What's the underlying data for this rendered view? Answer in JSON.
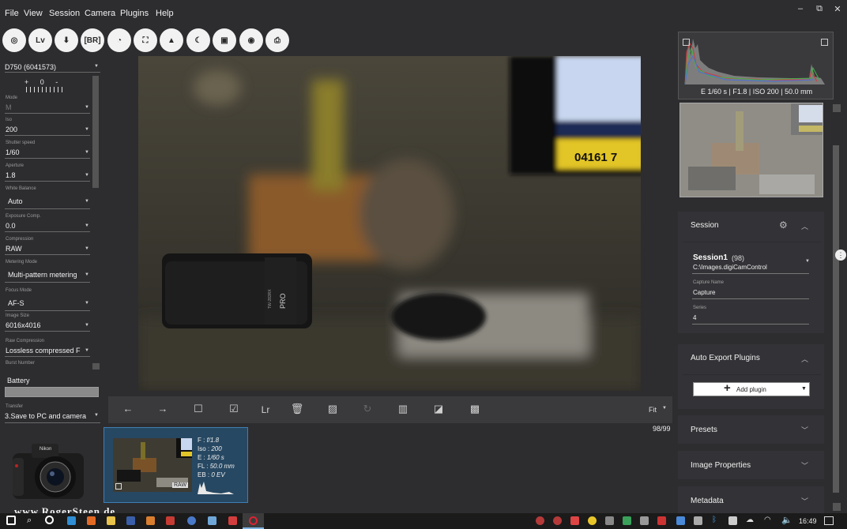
{
  "menu": [
    "File",
    "View",
    "Session",
    "Camera",
    "Plugins",
    "Help"
  ],
  "window_controls": {
    "minimize": "–",
    "restore": "⧉",
    "close": "✕"
  },
  "toolbar": {
    "buttons": [
      {
        "name": "aperture-icon",
        "glyph": "◎"
      },
      {
        "name": "liveview-button",
        "glyph": "Lv"
      },
      {
        "name": "download-icon",
        "glyph": "⬇"
      },
      {
        "name": "bracketing-button",
        "glyph": "[BR]"
      },
      {
        "name": "timelapse-icon",
        "glyph": "◔"
      },
      {
        "name": "focus-frame-icon",
        "glyph": "⛶"
      },
      {
        "name": "image-icon",
        "glyph": "▲"
      },
      {
        "name": "night-mode-icon",
        "glyph": "☾"
      },
      {
        "name": "gallery-icon",
        "glyph": "▣"
      },
      {
        "name": "wifi-icon",
        "glyph": "◉"
      },
      {
        "name": "print-icon",
        "glyph": "⎙"
      }
    ]
  },
  "camera": {
    "model": "D750 (6041573)",
    "meter_scale": "+ 0 -",
    "fields": [
      {
        "label": "Mode",
        "value": "M"
      },
      {
        "label": "Iso",
        "value": "200"
      },
      {
        "label": "Shutter speed",
        "value": "1/60"
      },
      {
        "label": "Aperture",
        "value": "1.8"
      },
      {
        "label": "White Balance",
        "value": "Auto"
      },
      {
        "label": "Exposure Comp.",
        "value": "0.0"
      },
      {
        "label": "Compression",
        "value": "RAW"
      },
      {
        "label": "Metering Mode",
        "value": "Multi-pattern metering"
      },
      {
        "label": "Focus Mode",
        "value": "AF-S"
      },
      {
        "label": "Image Size",
        "value": "6016x4016"
      },
      {
        "label": "Raw Compression",
        "value": "Lossless compressed F"
      },
      {
        "label": "Burst Number",
        "value": ""
      }
    ],
    "battery_label": "Battery",
    "transfer_label": "Transfer",
    "transfer_value": "3.Save to PC and camera",
    "watermark": "www.RogerSteen.de"
  },
  "photo": {
    "screen_number": "04161 7",
    "flash_brand": "PRO",
    "flash_model": "TW-283RX"
  },
  "image_toolbar": {
    "buttons": [
      "←",
      "→",
      "☐",
      "☑",
      "Lr",
      "🗑",
      "▨",
      "↻",
      "▥",
      "◪",
      "▩"
    ],
    "button_names": [
      "prev-icon",
      "next-icon",
      "select-none-icon",
      "select-all-icon",
      "lightroom-button",
      "delete-icon",
      "open-folder-icon",
      "rotate-icon",
      "compare-icon",
      "crop-icon",
      "fullscreen-icon"
    ],
    "zoom": "Fit",
    "counter": "98/99"
  },
  "thumbnail": {
    "f": "F : ",
    "f_val": "f/1.8",
    "iso": "Iso : ",
    "iso_val": "200",
    "e": "E : ",
    "e_val": "1/60 s",
    "fl": "FL : ",
    "fl_val": "50.0 mm",
    "eb": "EB : ",
    "eb_val": "0 EV",
    "badge": "RAW"
  },
  "histogram": {
    "caption": "E 1/60 s | F1.8 | ISO 200 | 50.0 mm"
  },
  "session": {
    "title": "Session",
    "name": "Session1",
    "count": "(98)",
    "path": "C:\\Images.digiCamControl",
    "capture_label": "Capture Name",
    "capture_value": "Capture",
    "series_label": "Series",
    "series_value": "4"
  },
  "auto_export": {
    "title": "Auto Export Plugins",
    "add_plugin": "Add plugin"
  },
  "collapsed_sections": [
    "Presets",
    "Image Properties",
    "Metadata"
  ],
  "taskbar": {
    "time": "16:49"
  },
  "colors": {
    "accent": "#3f7fb3",
    "background": "#2d2d30",
    "panel": "#333337"
  }
}
